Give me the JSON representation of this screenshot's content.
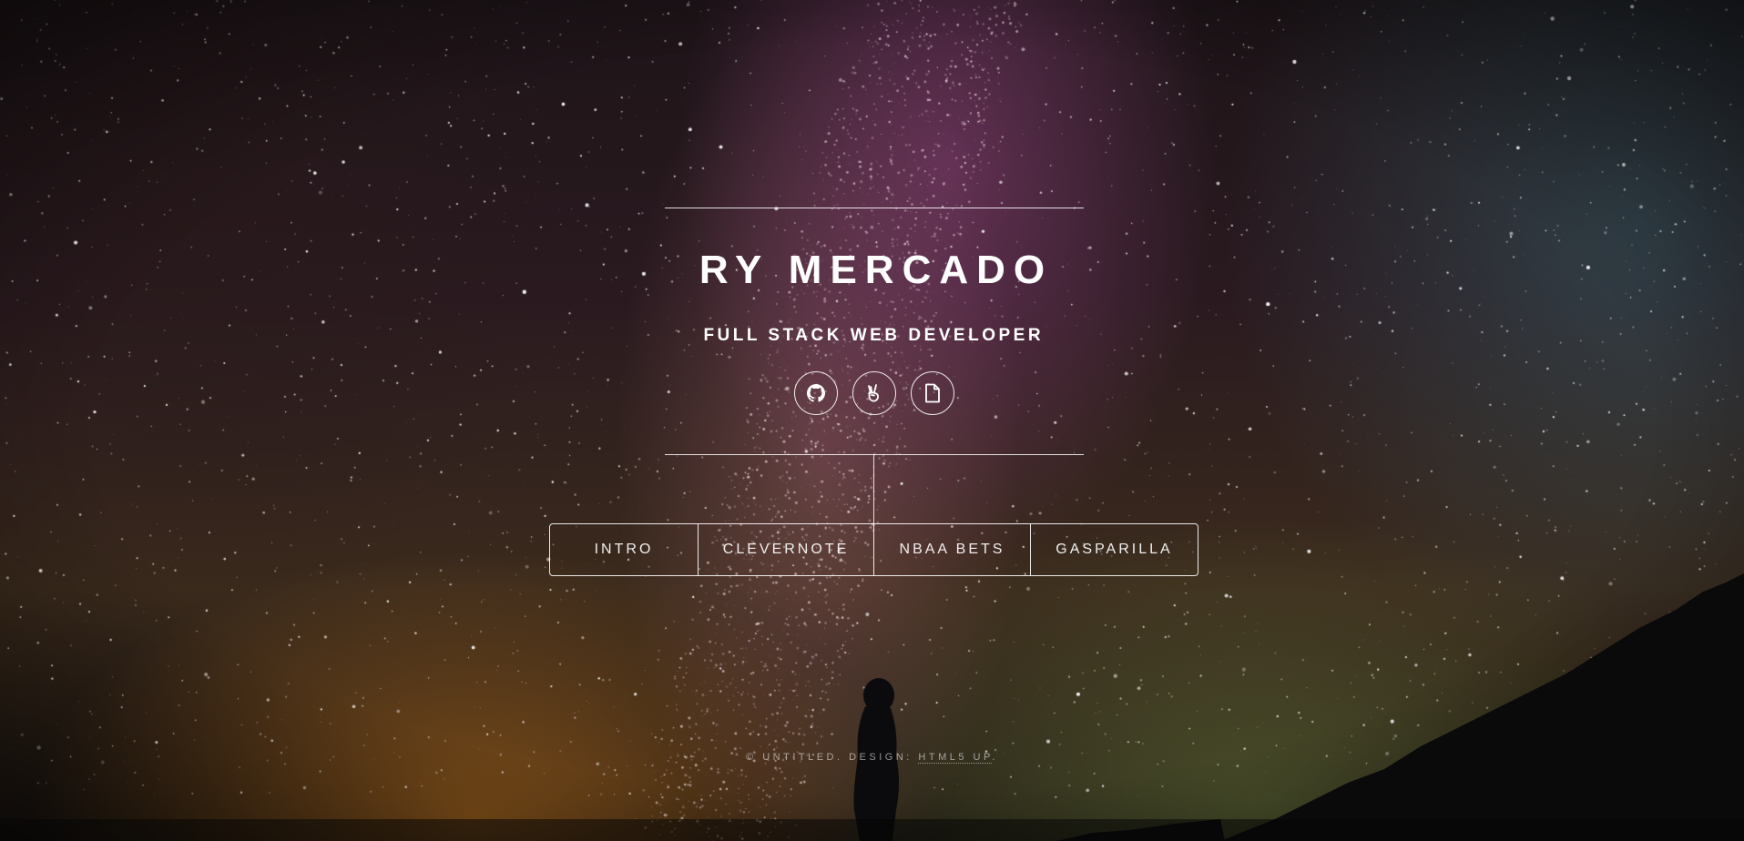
{
  "header": {
    "title": "RY MERCADO",
    "subtitle": "FULL STACK WEB DEVELOPER"
  },
  "social": [
    {
      "icon": "github-icon",
      "label": "GitHub"
    },
    {
      "icon": "angellist-icon",
      "label": "AngelList"
    },
    {
      "icon": "resume-file-icon",
      "label": "Resume"
    }
  ],
  "nav": {
    "items": [
      "INTRO",
      "CLEVERNOTE",
      "NBAA BETS",
      "GASPARILLA"
    ]
  },
  "footer": {
    "prefix": "© UNTITLED. DESIGN:",
    "link": "HTML5 UP",
    "suffix": "."
  },
  "colors": {
    "text": "#ffffff",
    "footer_text": "#9a9a9a"
  }
}
